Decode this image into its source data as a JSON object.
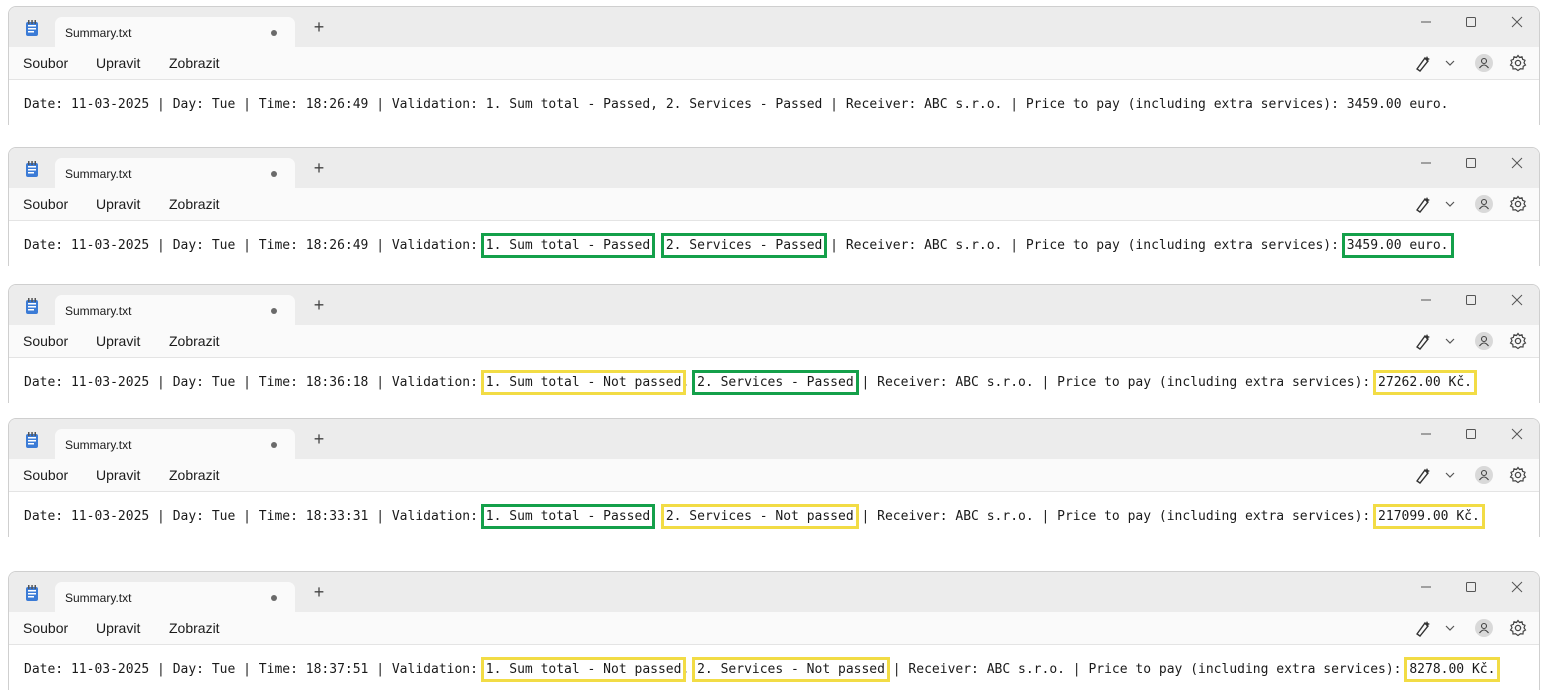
{
  "colors": {
    "passed": "#14a04a",
    "not_passed": "#f2dc45"
  },
  "windows": [
    {
      "tab_title": "Summary.txt",
      "new_tab_icon": "+",
      "menu": [
        "Soubor",
        "Upravit",
        "Zobrazit"
      ],
      "line": {
        "prefix": "Date: 11-03-2025 | Day: Tue | Time: 18:26:49 | Validation: ",
        "v1": "1. Sum total - Passed",
        "sep1": ", ",
        "v2": "2. Services - Passed",
        "mid": " | Receiver: ABC s.r.o. | Price to pay (including extra services): ",
        "price": "3459.00 euro.",
        "v1_status": "none",
        "v2_status": "none",
        "price_status": "none"
      }
    },
    {
      "tab_title": "Summary.txt",
      "new_tab_icon": "+",
      "menu": [
        "Soubor",
        "Upravit",
        "Zobrazit"
      ],
      "line": {
        "prefix": "Date: 11-03-2025 | Day: Tue | Time: 18:26:49 | Validation: ",
        "v1": "1. Sum total - Passed",
        "sep1": ", ",
        "v2": "2. Services - Passed",
        "mid": " | Receiver: ABC s.r.o. | Price to pay (including extra services): ",
        "price": "3459.00 euro.",
        "v1_status": "passed",
        "v2_status": "passed",
        "price_status": "passed"
      }
    },
    {
      "tab_title": "Summary.txt",
      "new_tab_icon": "+",
      "menu": [
        "Soubor",
        "Upravit",
        "Zobrazit"
      ],
      "line": {
        "prefix": "Date: 11-03-2025 | Day: Tue | Time: 18:36:18 | Validation: ",
        "v1": "1. Sum total - Not passed",
        "sep1": ", ",
        "v2": "2. Services - Passed",
        "mid": " | Receiver: ABC s.r.o. | Price to pay (including extra services): ",
        "price": "27262.00 Kč.",
        "v1_status": "not_passed",
        "v2_status": "passed",
        "price_status": "not_passed"
      }
    },
    {
      "tab_title": "Summary.txt",
      "new_tab_icon": "+",
      "menu": [
        "Soubor",
        "Upravit",
        "Zobrazit"
      ],
      "line": {
        "prefix": "Date: 11-03-2025 | Day: Tue | Time: 18:33:31 | Validation: ",
        "v1": "1. Sum total - Passed",
        "sep1": ", ",
        "v2": "2. Services - Not passed",
        "mid": " | Receiver: ABC s.r.o. | Price to pay (including extra services): ",
        "price": "217099.00 Kč.",
        "v1_status": "passed",
        "v2_status": "not_passed",
        "price_status": "not_passed"
      }
    },
    {
      "tab_title": "Summary.txt",
      "new_tab_icon": "+",
      "menu": [
        "Soubor",
        "Upravit",
        "Zobrazit"
      ],
      "line": {
        "prefix": "Date: 11-03-2025 | Day: Tue | Time: 18:37:51 | Validation: ",
        "v1": "1. Sum total - Not passed",
        "sep1": ", ",
        "v2": "2. Services - Not passed",
        "mid": " | Receiver: ABC s.r.o. | Price to pay (including extra services): ",
        "price": "8278.00 Kč.",
        "v1_status": "not_passed",
        "v2_status": "not_passed",
        "price_status": "not_passed"
      }
    }
  ]
}
